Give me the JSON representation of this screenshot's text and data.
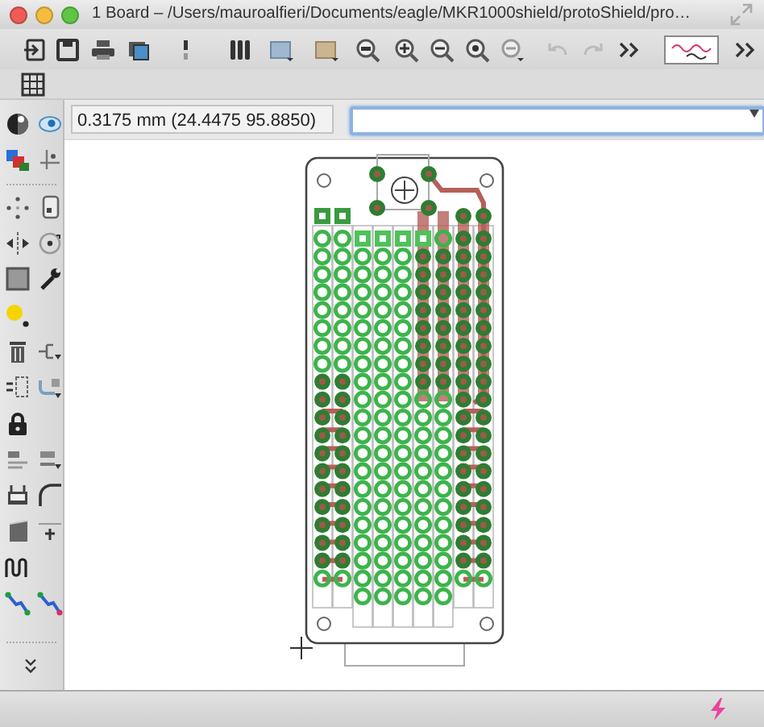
{
  "window": {
    "title": "1 Board – /Users/mauroalfieri/Documents/eagle/MKR1000shield/protoShield/pro…"
  },
  "coordinate_display": "0.3175 mm (24.4475 95.8850)",
  "command_field": {
    "focused": true
  }
}
